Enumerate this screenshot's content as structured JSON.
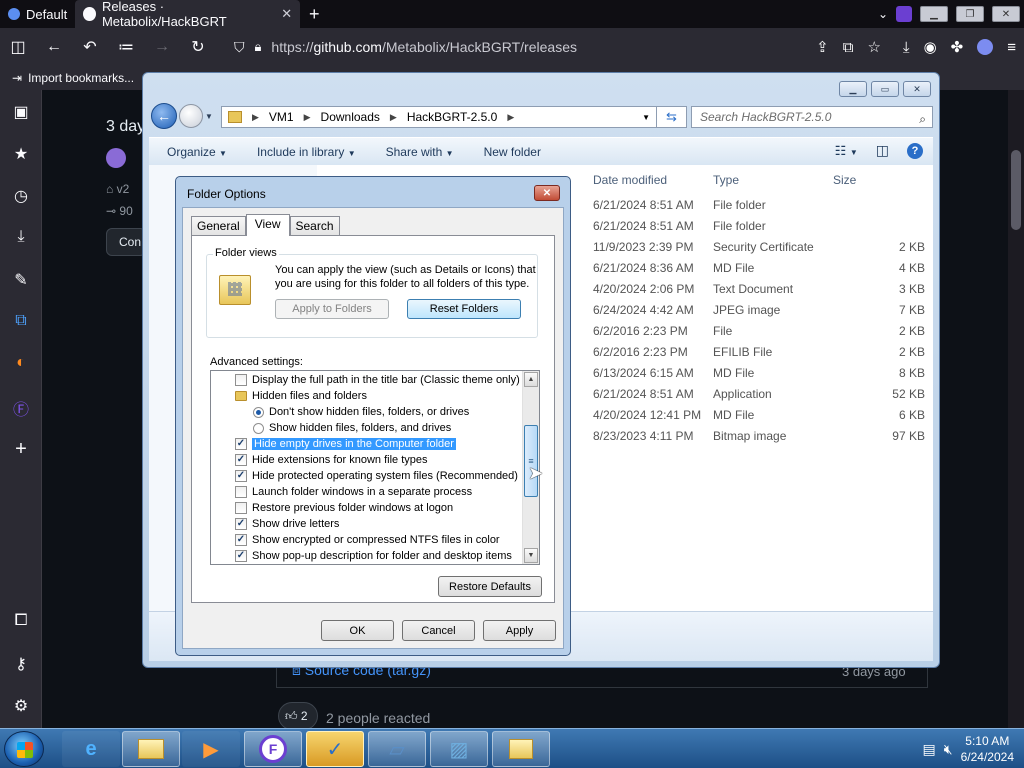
{
  "browser": {
    "profile_tab": "Default",
    "tab_title": "Releases · Metabolix/HackBGRT",
    "url_prefix": "https://",
    "url_host": "github.com",
    "url_path": "/Metabolix/HackBGRT/releases",
    "bookmark_label": "Import bookmarks..."
  },
  "github": {
    "heading": "3 day",
    "tag_prefix": "v2",
    "commit_prefix": "90",
    "button_prefix": "Con",
    "source_code_label": "Source code (tar.gz)",
    "source_code_time": "3 days ago",
    "reaction_count": "2",
    "reaction_text": "2 people reacted"
  },
  "explorer": {
    "breadcrumbs": [
      "VM1",
      "Downloads",
      "HackBGRT-2.5.0"
    ],
    "search_placeholder": "Search HackBGRT-2.5.0",
    "toolbar": {
      "organize": "Organize",
      "include_in_library": "Include in library",
      "share_with": "Share with",
      "new_folder": "New folder"
    },
    "columns": {
      "date_modified": "Date modified",
      "type": "Type",
      "size": "Size"
    },
    "rows": [
      {
        "date": "6/21/2024 8:51 AM",
        "type": "File folder",
        "size": ""
      },
      {
        "date": "6/21/2024 8:51 AM",
        "type": "File folder",
        "size": ""
      },
      {
        "date": "11/9/2023 2:39 PM",
        "type": "Security Certificate",
        "size": "2 KB"
      },
      {
        "date": "6/21/2024 8:36 AM",
        "type": "MD File",
        "size": "4 KB"
      },
      {
        "date": "4/20/2024 2:06 PM",
        "type": "Text Document",
        "size": "3 KB"
      },
      {
        "date": "6/24/2024 4:42 AM",
        "type": "JPEG image",
        "size": "7 KB"
      },
      {
        "date": "6/2/2016 2:23 PM",
        "type": "File",
        "size": "2 KB"
      },
      {
        "date": "6/2/2016 2:23 PM",
        "type": "EFILIB File",
        "size": "2 KB"
      },
      {
        "date": "6/13/2024 6:15 AM",
        "type": "MD File",
        "size": "8 KB"
      },
      {
        "date": "6/21/2024 8:51 AM",
        "type": "Application",
        "size": "52 KB"
      },
      {
        "date": "4/20/2024 12:41 PM",
        "type": "MD File",
        "size": "6 KB"
      },
      {
        "date": "8/23/2023 4:11 PM",
        "type": "Bitmap image",
        "size": "97 KB"
      }
    ]
  },
  "dialog": {
    "title": "Folder Options",
    "tabs": [
      "General",
      "View",
      "Search"
    ],
    "folder_views_label": "Folder views",
    "folder_views_text": "You can apply the view (such as Details or Icons) that you are using for this folder to all folders of this type.",
    "apply_to_folders": "Apply to Folders",
    "reset_folders": "Reset Folders",
    "advanced_label": "Advanced settings:",
    "settings": [
      {
        "kind": "checkbox",
        "checked": false,
        "indent": 1,
        "label": "Display the full path in the title bar (Classic theme only)"
      },
      {
        "kind": "folder",
        "indent": 1,
        "label": "Hidden files and folders"
      },
      {
        "kind": "radio",
        "checked": true,
        "indent": 2,
        "label": "Don't show hidden files, folders, or drives"
      },
      {
        "kind": "radio",
        "checked": false,
        "indent": 2,
        "label": "Show hidden files, folders, and drives"
      },
      {
        "kind": "checkbox",
        "checked": true,
        "indent": 1,
        "selected": true,
        "label": "Hide empty drives in the Computer folder"
      },
      {
        "kind": "checkbox",
        "checked": true,
        "indent": 1,
        "label": "Hide extensions for known file types"
      },
      {
        "kind": "checkbox",
        "checked": true,
        "indent": 1,
        "label": "Hide protected operating system files (Recommended)"
      },
      {
        "kind": "checkbox",
        "checked": false,
        "indent": 1,
        "label": "Launch folder windows in a separate process"
      },
      {
        "kind": "checkbox",
        "checked": false,
        "indent": 1,
        "label": "Restore previous folder windows at logon"
      },
      {
        "kind": "checkbox",
        "checked": true,
        "indent": 1,
        "label": "Show drive letters"
      },
      {
        "kind": "checkbox",
        "checked": true,
        "indent": 1,
        "label": "Show encrypted or compressed NTFS files in color"
      },
      {
        "kind": "checkbox",
        "checked": true,
        "indent": 1,
        "label": "Show pop-up description for folder and desktop items"
      }
    ],
    "restore_defaults": "Restore Defaults",
    "ok": "OK",
    "cancel": "Cancel",
    "apply": "Apply"
  },
  "taskbar": {
    "time": "5:10 AM",
    "date": "6/24/2024"
  }
}
